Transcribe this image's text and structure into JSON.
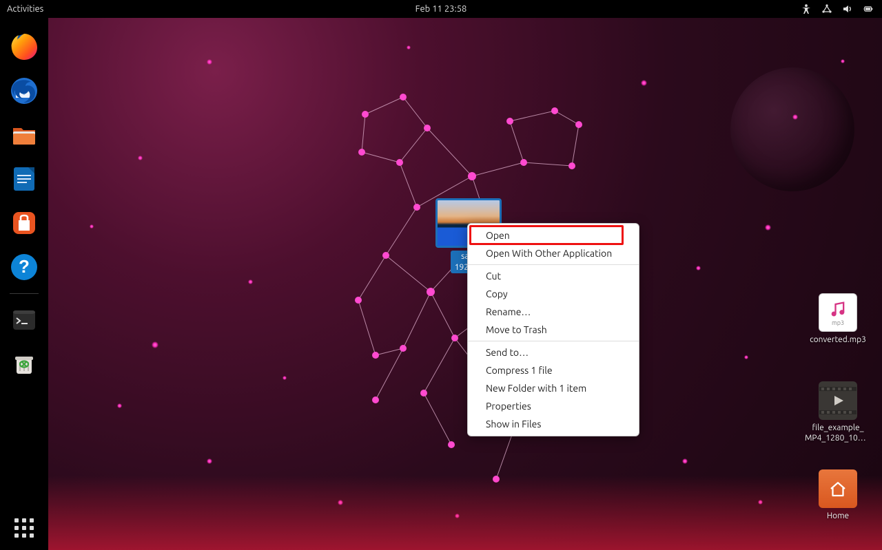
{
  "topbar": {
    "activities": "Activities",
    "clock": "Feb 11  23:58",
    "icons": [
      "accessibility-icon",
      "network-icon",
      "volume-icon",
      "battery-icon"
    ]
  },
  "dock": {
    "apps": [
      {
        "name": "firefox",
        "title": "Firefox"
      },
      {
        "name": "thunderbird",
        "title": "Thunderbird"
      },
      {
        "name": "files",
        "title": "Files"
      },
      {
        "name": "writer",
        "title": "LibreOffice Writer"
      },
      {
        "name": "software",
        "title": "Ubuntu Software"
      },
      {
        "name": "help",
        "title": "Help"
      }
    ],
    "extra": [
      {
        "name": "terminal",
        "title": "Terminal"
      },
      {
        "name": "trash",
        "title": "Trash"
      }
    ],
    "show_apps_title": "Show Applications"
  },
  "desktop": {
    "selected_file": {
      "name_line1": "sam",
      "name_line2": "1920×1"
    },
    "icons": [
      {
        "id": "mp3",
        "label": "converted.mp3",
        "badge": "mp3"
      },
      {
        "id": "mp4",
        "label1": "file_example_",
        "label2": "MP4_1280_10M…"
      },
      {
        "id": "home",
        "label": "Home"
      }
    ]
  },
  "context_menu": {
    "items": [
      {
        "id": "open",
        "label": "Open",
        "highlighted": true
      },
      {
        "id": "open_with",
        "label": "Open With Other Application"
      },
      {
        "sep": true
      },
      {
        "id": "cut",
        "label": "Cut"
      },
      {
        "id": "copy",
        "label": "Copy"
      },
      {
        "id": "rename",
        "label": "Rename…"
      },
      {
        "id": "trash",
        "label": "Move to Trash"
      },
      {
        "sep": true
      },
      {
        "id": "sendto",
        "label": "Send to…"
      },
      {
        "id": "compress",
        "label": "Compress 1 file"
      },
      {
        "id": "newfolder",
        "label": "New Folder with 1 item"
      },
      {
        "id": "properties",
        "label": "Properties"
      },
      {
        "id": "showinfiles",
        "label": "Show in Files"
      }
    ]
  }
}
